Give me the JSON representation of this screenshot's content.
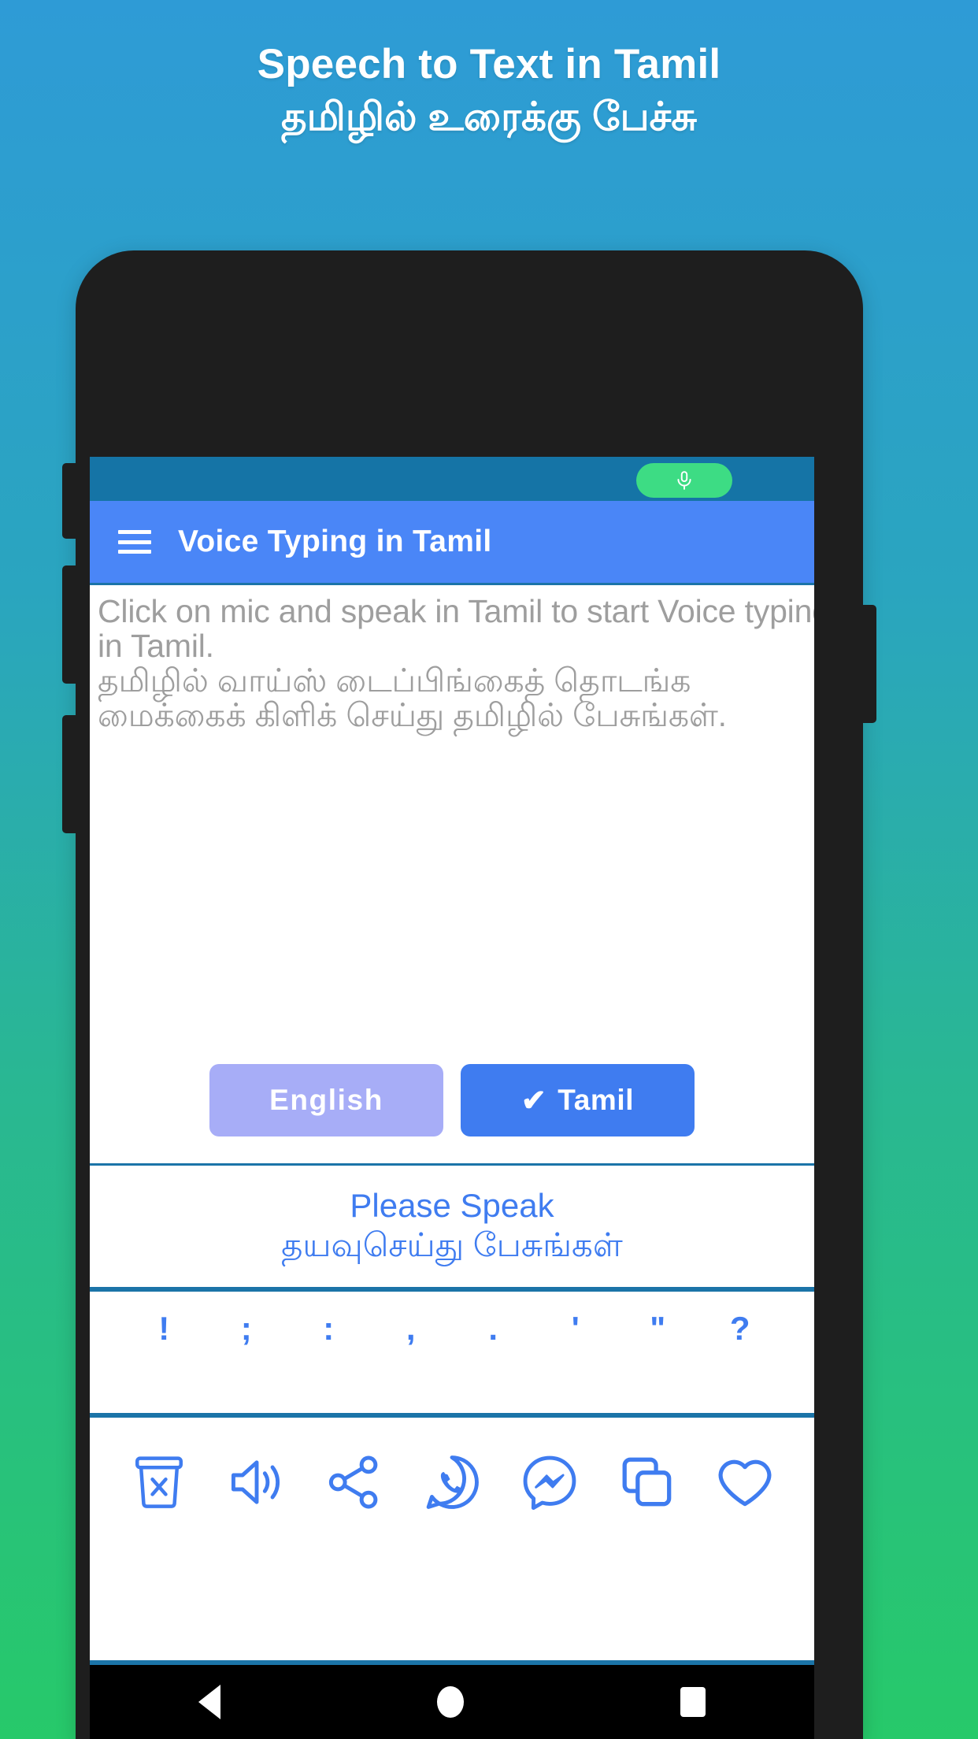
{
  "promo": {
    "line1": "Speech to Text in Tamil",
    "line2": "தமிழில் உரைக்கு பேச்சு"
  },
  "colors": {
    "bg_top": "#2e9bd6",
    "bg_bottom": "#27c96a",
    "appbar": "#4a86f7",
    "statusbar": "#1574a6",
    "accent_blue": "#3f7cf0",
    "divider": "#1b74a8",
    "mic_pill": "#3ddc84",
    "inactive_button": "#a7adf7",
    "placeholder_text": "#9e9e9e"
  },
  "statusbar": {
    "mic_icon": "microphone-icon"
  },
  "appbar": {
    "menu_icon": "hamburger-menu-icon",
    "title": "Voice Typing in Tamil"
  },
  "editor": {
    "placeholder": "Click on mic and speak in Tamil to start Voice typing in Tamil.\nதமிழில் வாய்ஸ் டைப்பிங்கைத் தொடங்க மைக்கைக் கிளிக் செய்து தமிழில் பேசுங்கள்.",
    "value": ""
  },
  "language_buttons": [
    {
      "label": "English",
      "selected": false,
      "check": ""
    },
    {
      "label": "Tamil",
      "selected": true,
      "check": "✔"
    }
  ],
  "status_panel": {
    "english": "Please Speak",
    "tamil": "தயவுசெய்து பேசுங்கள்"
  },
  "punctuation_keys": [
    "!",
    ";",
    ":",
    ",",
    ".",
    "'",
    "\"",
    "?"
  ],
  "action_buttons": [
    {
      "name": "delete-icon",
      "label": "Clear text"
    },
    {
      "name": "speaker-icon",
      "label": "Speak out"
    },
    {
      "name": "share-icon",
      "label": "Share"
    },
    {
      "name": "whatsapp-icon",
      "label": "WhatsApp"
    },
    {
      "name": "messenger-icon",
      "label": "Messenger"
    },
    {
      "name": "copy-icon",
      "label": "Copy"
    },
    {
      "name": "heart-icon",
      "label": "Favorite"
    }
  ],
  "navbar": {
    "back": "back-icon",
    "home": "home-icon",
    "recents": "recents-icon"
  }
}
